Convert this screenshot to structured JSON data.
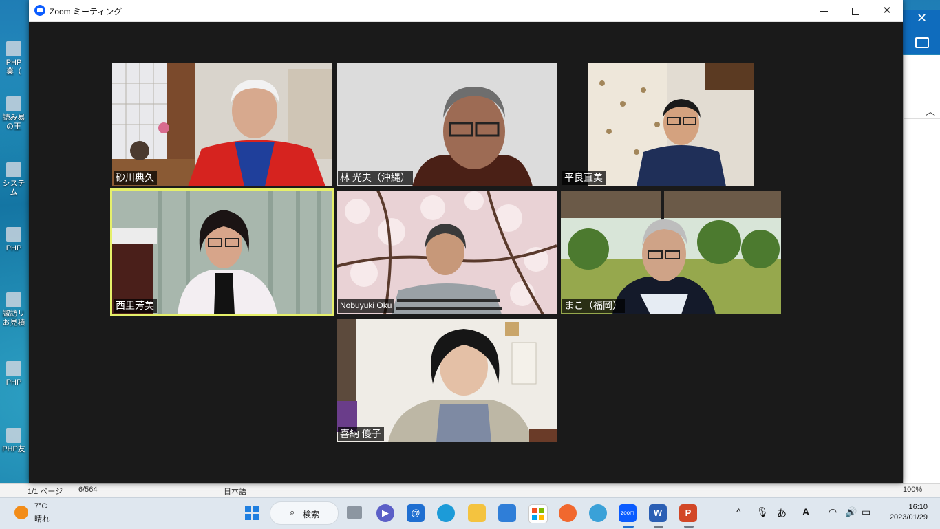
{
  "desktop": {
    "icons": [
      {
        "label": "PHP\n業（"
      },
      {
        "label": "読み易\nの王"
      },
      {
        "label": "システム"
      },
      {
        "label": "PHP"
      },
      {
        "label": "諏訪リ\nお見積"
      },
      {
        "label": "PHP"
      },
      {
        "label": "PHP友"
      }
    ]
  },
  "word_status": {
    "page": "1/1 ページ",
    "words": "6/564",
    "lang": "日本語",
    "zoom": "100%"
  },
  "window": {
    "title": "Zoom ミーティング",
    "controls": {
      "minimize": "minimize",
      "maximize": "maximize",
      "close": "✕"
    }
  },
  "participants": [
    {
      "name": "砂川典久",
      "speaking": false
    },
    {
      "name": "林 光夫（沖縄）",
      "speaking": false
    },
    {
      "name": "平良直美",
      "speaking": false
    },
    {
      "name": "西里芳美",
      "speaking": true
    },
    {
      "name": "Nobuyuki Oku",
      "speaking": false
    },
    {
      "name": "まこ（福岡）",
      "speaking": false
    },
    {
      "name": "喜納 優子",
      "speaking": false
    }
  ],
  "taskbar": {
    "weather": {
      "temp": "7°C",
      "condition": "晴れ"
    },
    "search_label": "検索",
    "apps": [
      {
        "name": "start-icon"
      },
      {
        "name": "task-view-icon"
      },
      {
        "name": "chat-icon"
      },
      {
        "name": "mail-at-icon"
      },
      {
        "name": "edge-icon"
      },
      {
        "name": "file-explorer-icon"
      },
      {
        "name": "mail-icon"
      },
      {
        "name": "store-icon"
      },
      {
        "name": "app-icon"
      },
      {
        "name": "weather-app-icon"
      },
      {
        "name": "zoom-icon"
      },
      {
        "name": "word-icon"
      },
      {
        "name": "powerpoint-icon"
      }
    ],
    "tray": {
      "chevron": "^",
      "ime": "あ"
    },
    "clock": {
      "time": "16:10",
      "date": "2023/01/29"
    }
  }
}
